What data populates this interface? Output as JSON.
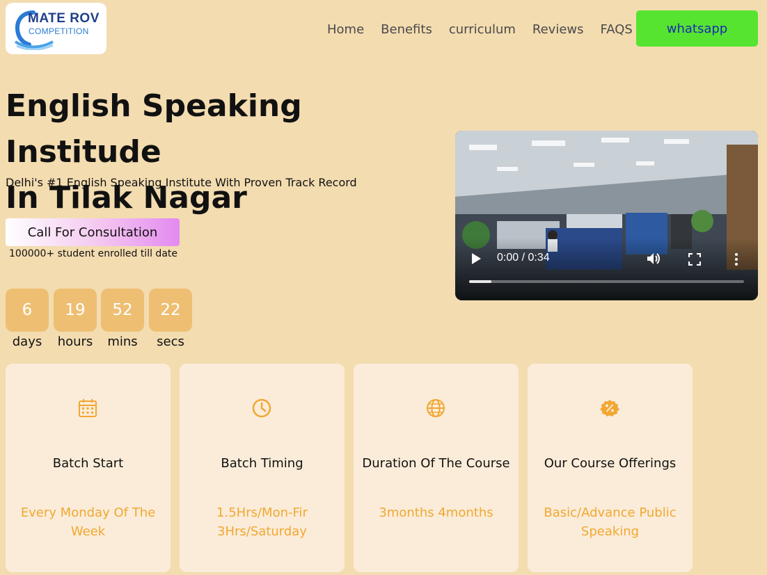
{
  "logo": {
    "line1": "MATE ROV",
    "line2": "COMPETITION"
  },
  "nav": {
    "items": [
      "Home",
      "Benefits",
      "curriculum",
      "Reviews",
      "FAQS"
    ],
    "whatsapp_label": "whatsapp"
  },
  "hero": {
    "title_line1": "English Speaking Institude",
    "title_line2": "In Tilak Nagar",
    "subtitle": "Delhi's #1 English Speaking Institute With Proven Track Record",
    "cta_label": "Call For Consultation",
    "cta_note": "100000+ student enrolled till date"
  },
  "countdown": [
    {
      "value": "6",
      "label": "days"
    },
    {
      "value": "19",
      "label": "hours"
    },
    {
      "value": "52",
      "label": "mins"
    },
    {
      "value": "22",
      "label": "secs"
    }
  ],
  "video": {
    "time": "0:00 / 0:34",
    "progress_fraction": 0.08
  },
  "cards": [
    {
      "icon": "calendar-icon",
      "title": "Batch Start",
      "value": "Every Monday Of The Week"
    },
    {
      "icon": "clock-icon",
      "title": "Batch Timing",
      "value": "1.5Hrs/Mon-Fir 3Hrs/Saturday"
    },
    {
      "icon": "globe-icon",
      "title": "Duration Of The Course",
      "value": "3months 4months"
    },
    {
      "icon": "discount-badge-icon",
      "title": "Our Course Offerings",
      "value": "Basic/Advance Public Speaking"
    }
  ],
  "colors": {
    "background": "#f3dcb0",
    "whatsapp": "#56e430",
    "accent": "#f2a732",
    "countdown_box": "#eebf72",
    "card_bg": "#faecd8"
  }
}
